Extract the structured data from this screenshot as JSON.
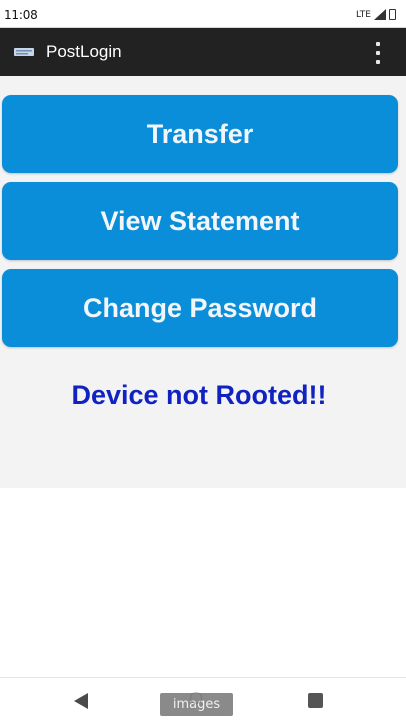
{
  "status_bar": {
    "time": "11:08",
    "network": "LTE",
    "icons": [
      "signal-icon",
      "battery-icon"
    ]
  },
  "app_bar": {
    "title": "PostLogin",
    "icons": [
      "app-icon",
      "overflow-menu-icon"
    ]
  },
  "actions": {
    "transfer_label": "Transfer",
    "view_statement_label": "View Statement",
    "change_password_label": "Change Password"
  },
  "device_status": "Device not Rooted!!",
  "navigation_bar": {
    "home_label": "images",
    "icons": [
      "back-icon",
      "home-icon",
      "recents-icon"
    ]
  },
  "colors": {
    "app_bar": "#222222",
    "button": "#0a8ed9",
    "button_text": "#f2f6fa",
    "status_text": "#1122c2",
    "content_background": "#f3f3f3"
  }
}
